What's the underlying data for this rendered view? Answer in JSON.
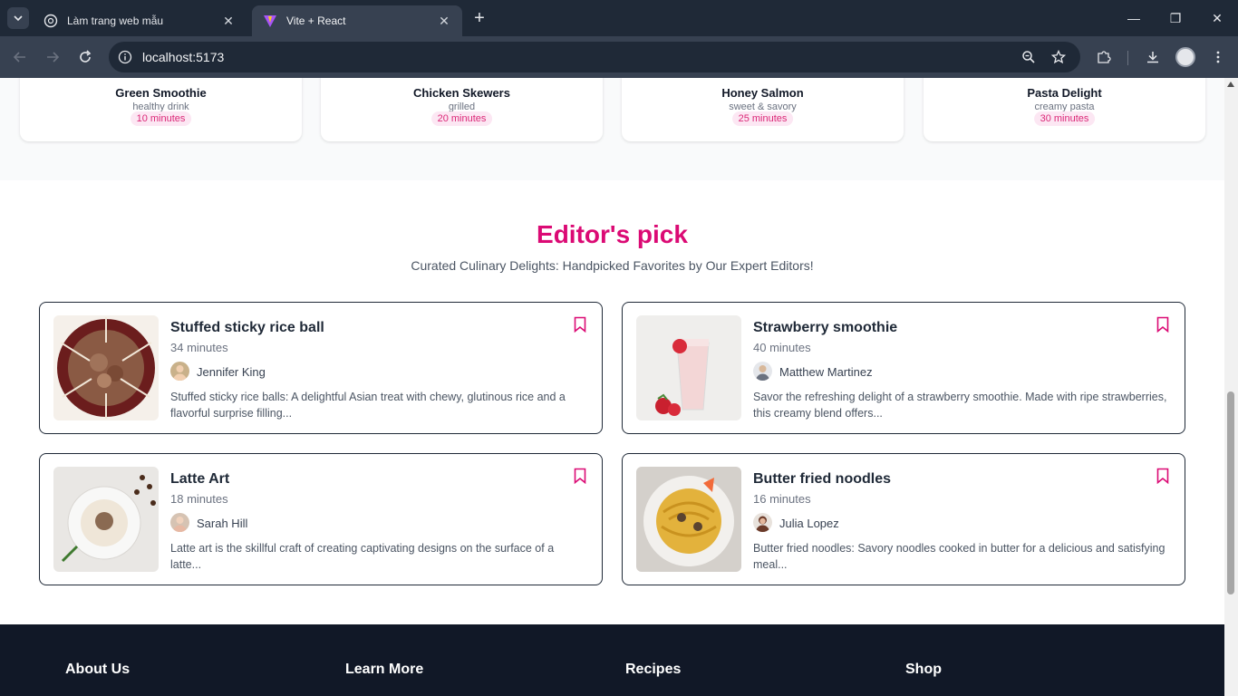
{
  "browser": {
    "tabs": [
      {
        "title": "Làm trang web mẫu",
        "active": false
      },
      {
        "title": "Vite + React",
        "active": true
      }
    ],
    "url": "localhost:5173"
  },
  "strip": {
    "cards": [
      {
        "name": "Green Smoothie",
        "sub": "healthy drink",
        "time": "10 minutes"
      },
      {
        "name": "Chicken Skewers",
        "sub": "grilled",
        "time": "20 minutes"
      },
      {
        "name": "Honey Salmon",
        "sub": "sweet & savory",
        "time": "25 minutes"
      },
      {
        "name": "Pasta Delight",
        "sub": "creamy pasta",
        "time": "30 minutes"
      }
    ]
  },
  "editors_pick": {
    "title": "Editor's pick",
    "subtitle": "Curated Culinary Delights: Handpicked Favorites by Our Expert Editors!",
    "cards": [
      {
        "title": "Stuffed sticky rice ball",
        "time": "34 minutes",
        "author": "Jennifer King",
        "description": "Stuffed sticky rice balls: A delightful Asian treat with chewy, glutinous rice and a flavorful surprise filling..."
      },
      {
        "title": "Strawberry smoothie",
        "time": "40 minutes",
        "author": "Matthew Martinez",
        "description": "Savor the refreshing delight of a strawberry smoothie. Made with ripe strawberries, this creamy blend offers..."
      },
      {
        "title": "Latte Art",
        "time": "18 minutes",
        "author": "Sarah Hill",
        "description": "Latte art is the skillful craft of creating captivating designs on the surface of a latte..."
      },
      {
        "title": "Butter fried noodles",
        "time": "16 minutes",
        "author": "Julia Lopez",
        "description": "Butter fried noodles: Savory noodles cooked in butter for a delicious and satisfying meal..."
      }
    ]
  },
  "footer": {
    "columns": [
      "About Us",
      "Learn More",
      "Recipes",
      "Shop"
    ]
  },
  "colors": {
    "accent": "#db0a74",
    "footer_bg": "#111827",
    "chrome_bg": "#1f2937"
  }
}
